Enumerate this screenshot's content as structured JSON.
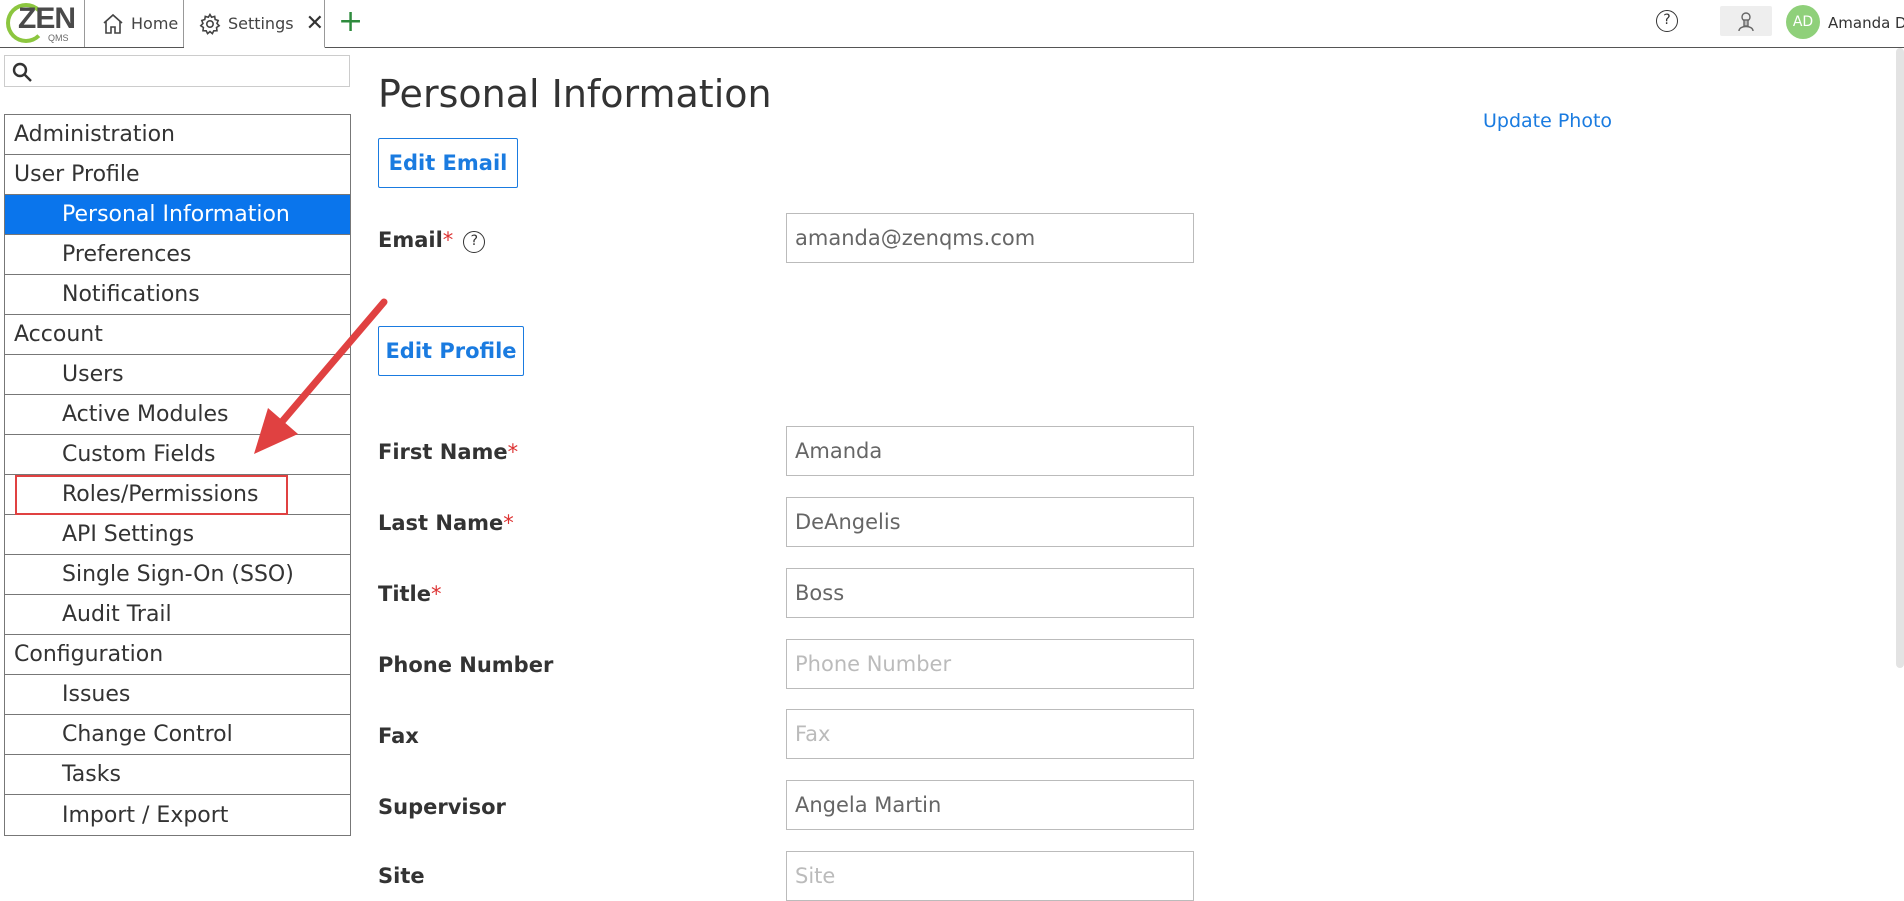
{
  "topbar": {
    "logo_text": "ZEN",
    "logo_sub": "QMS",
    "tabs": [
      {
        "label": "Home"
      },
      {
        "label": "Settings"
      }
    ],
    "help_symbol": "?",
    "user_initials": "AD",
    "user_name": "Amanda D"
  },
  "sidebar": {
    "search_placeholder": "",
    "items": [
      {
        "label": "Administration",
        "type": "group"
      },
      {
        "label": "User Profile",
        "type": "group"
      },
      {
        "label": "Personal Information",
        "type": "sub",
        "active": true
      },
      {
        "label": "Preferences",
        "type": "sub"
      },
      {
        "label": "Notifications",
        "type": "sub"
      },
      {
        "label": "Account",
        "type": "group"
      },
      {
        "label": "Users",
        "type": "sub"
      },
      {
        "label": "Active Modules",
        "type": "sub"
      },
      {
        "label": "Custom Fields",
        "type": "sub"
      },
      {
        "label": "Roles/Permissions",
        "type": "sub"
      },
      {
        "label": "API Settings",
        "type": "sub"
      },
      {
        "label": "Single Sign-On (SSO)",
        "type": "sub"
      },
      {
        "label": "Audit Trail",
        "type": "sub"
      },
      {
        "label": "Configuration",
        "type": "group"
      },
      {
        "label": "Issues",
        "type": "sub"
      },
      {
        "label": "Change Control",
        "type": "sub"
      },
      {
        "label": "Tasks",
        "type": "sub"
      },
      {
        "label": "Import / Export",
        "type": "sub"
      }
    ]
  },
  "main": {
    "title": "Personal Information",
    "update_photo": "Update Photo",
    "edit_email": "Edit Email",
    "edit_profile": "Edit Profile",
    "required_mark": "*",
    "fields": {
      "email": {
        "label": "Email",
        "value": "amanda@zenqms.com",
        "placeholder": ""
      },
      "first_name": {
        "label": "First Name",
        "value": "Amanda",
        "placeholder": ""
      },
      "last_name": {
        "label": "Last Name",
        "value": "DeAngelis",
        "placeholder": ""
      },
      "title": {
        "label": "Title",
        "value": "Boss",
        "placeholder": ""
      },
      "phone": {
        "label": "Phone Number",
        "value": "",
        "placeholder": "Phone Number"
      },
      "fax": {
        "label": "Fax",
        "value": "",
        "placeholder": "Fax"
      },
      "supervisor": {
        "label": "Supervisor",
        "value": "Angela Martin",
        "placeholder": ""
      },
      "site": {
        "label": "Site",
        "value": "",
        "placeholder": "Site"
      }
    }
  },
  "colors": {
    "accent": "#0a75ec",
    "link": "#1a7be0",
    "highlight": "#e04141",
    "logo_green": "#8cc63f"
  }
}
